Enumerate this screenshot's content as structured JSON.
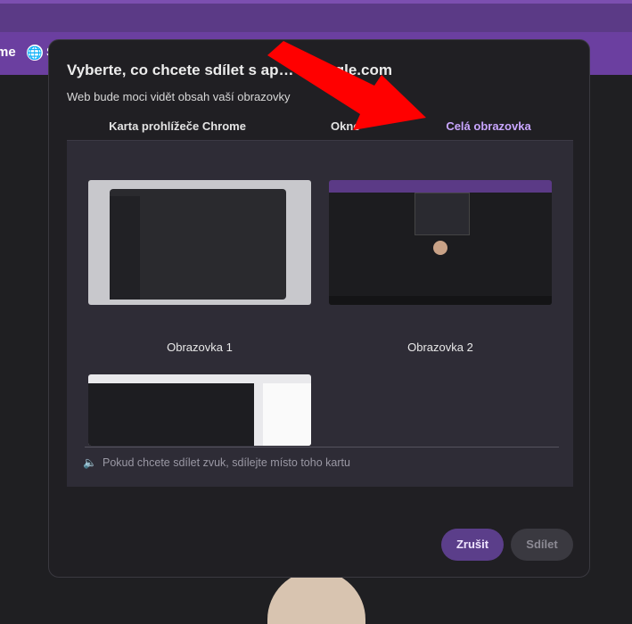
{
  "browser": {
    "toolbar_text_partial": "me",
    "toolbar_text_partial2": "S"
  },
  "dialog": {
    "title": "Vyberte, co chcete sdílet s ap… t.google.com",
    "subtitle": "Web bude moci vidět obsah vaší obrazovky",
    "tabs": [
      {
        "label": "Karta prohlížeče Chrome"
      },
      {
        "label": "Okno"
      },
      {
        "label": "Celá obrazovka",
        "selected": true
      }
    ],
    "screens": [
      {
        "label": "Obrazovka 1"
      },
      {
        "label": "Obrazovka 2"
      }
    ],
    "audio_hint": "Pokud chcete sdílet zvuk, sdílejte místo toho kartu",
    "buttons": {
      "cancel": "Zrušit",
      "share": "Sdílet"
    }
  },
  "colors": {
    "accent": "#c9a6ff",
    "purple_bar": "#6b3fa0",
    "arrow": "#ff0000"
  }
}
